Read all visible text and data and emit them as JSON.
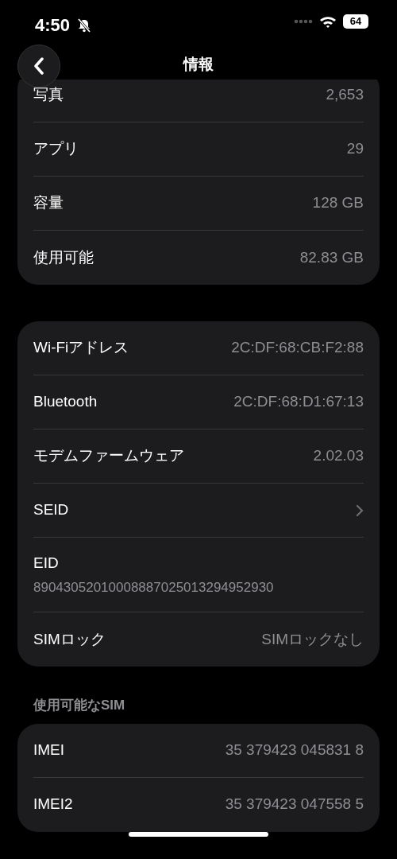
{
  "status_bar": {
    "time": "4:50",
    "battery": "64"
  },
  "nav": {
    "title": "情報"
  },
  "sections": [
    {
      "rows": [
        {
          "kind": "value",
          "label": "写真",
          "value": "2,653"
        },
        {
          "kind": "value",
          "label": "アプリ",
          "value": "29"
        },
        {
          "kind": "value",
          "label": "容量",
          "value": "128 GB"
        },
        {
          "kind": "value",
          "label": "使用可能",
          "value": "82.83 GB"
        }
      ]
    },
    {
      "rows": [
        {
          "kind": "value",
          "label": "Wi-Fiアドレス",
          "value": "2C:DF:68:CB:F2:88"
        },
        {
          "kind": "value",
          "label": "Bluetooth",
          "value": "2C:DF:68:D1:67:13"
        },
        {
          "kind": "value",
          "label": "モデムファームウェア",
          "value": "2.02.03"
        },
        {
          "kind": "link",
          "label": "SEID"
        },
        {
          "kind": "stacked",
          "label": "EID",
          "value": "89043052010008887025013294952930"
        },
        {
          "kind": "value",
          "label": "SIMロック",
          "value": "SIMロックなし"
        }
      ]
    },
    {
      "header": "使用可能なSIM",
      "rows": [
        {
          "kind": "value",
          "label": "IMEI",
          "value": "35 379423 045831 8"
        },
        {
          "kind": "value",
          "label": "IMEI2",
          "value": "35 379423 047558 5"
        }
      ]
    }
  ]
}
